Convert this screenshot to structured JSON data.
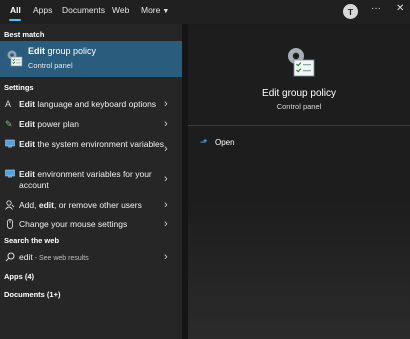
{
  "top_tabs": [
    {
      "label": "All"
    },
    {
      "label": "Apps"
    },
    {
      "label": "Documents"
    },
    {
      "label": "Web"
    },
    {
      "label": "More"
    }
  ],
  "avatar_letter": "T",
  "sections": {
    "best_match": "Best match",
    "settings": "Settings",
    "search_web": "Search the web",
    "apps": "Apps (4)",
    "documents": "Documents (1+)"
  },
  "best_match": {
    "title_bold": "Edit",
    "title_rest": " group policy",
    "subtitle": "Control panel"
  },
  "settings_items": [
    {
      "bold": "Edit",
      "rest": " language and keyboard options",
      "icon": "language-icon"
    },
    {
      "bold": "Edit",
      "rest": " power plan",
      "icon": "power-plan-icon"
    },
    {
      "bold": "Edit",
      "rest": " the system environment variables",
      "icon": "monitor-icon"
    },
    {
      "bold": "Edit",
      "rest": " environment variables for your account",
      "icon": "monitor-icon"
    },
    {
      "pre": "Add, ",
      "bold": "edit",
      "rest": ", or remove other users",
      "icon": "user-icon"
    },
    {
      "pre": "",
      "bold": "",
      "rest": "Change your mouse settings",
      "icon": "mouse-icon"
    }
  ],
  "web_search": {
    "query": "edit",
    "suffix": " - See web results"
  },
  "detail": {
    "title": "Edit group policy",
    "subtitle": "Control panel",
    "open_label": "Open"
  },
  "colors": {
    "accent": "#4cc2ff",
    "selection": "#2a5c7e"
  }
}
